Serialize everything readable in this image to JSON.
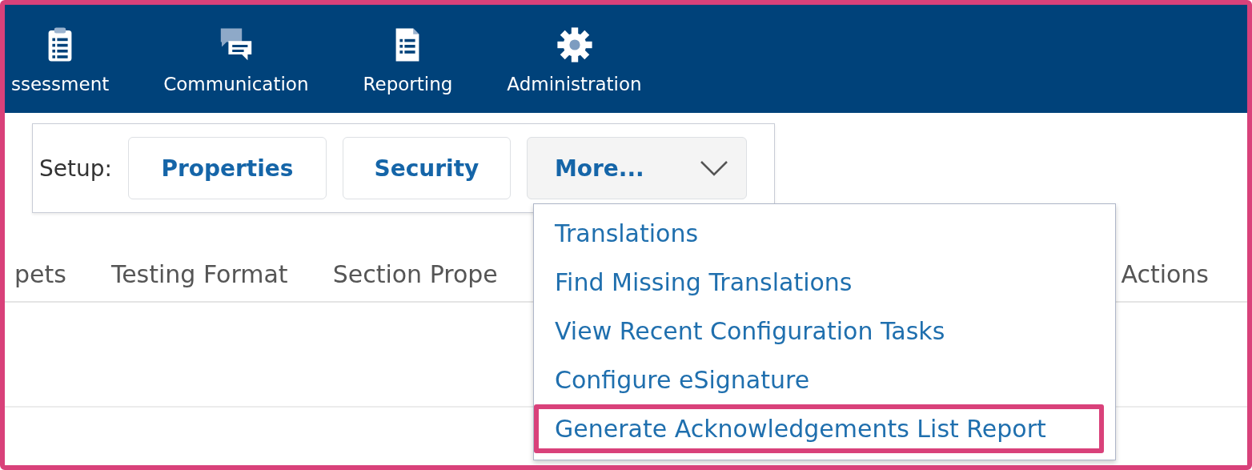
{
  "nav": {
    "items": [
      {
        "label": "ssessment",
        "kind": "clipboard"
      },
      {
        "label": "Communication",
        "kind": "chat"
      },
      {
        "label": "Reporting",
        "kind": "document"
      },
      {
        "label": "Administration",
        "kind": "gear"
      }
    ]
  },
  "setup": {
    "label": "Setup:",
    "buttons": [
      {
        "label": "Properties",
        "kind": "plain"
      },
      {
        "label": "Security",
        "kind": "plain"
      },
      {
        "label": "More...",
        "kind": "dropdown"
      }
    ]
  },
  "tabs": [
    "pets",
    "Testing Format",
    "Section Prope"
  ],
  "tab_right": "Actions",
  "menu": {
    "items": [
      {
        "label": "Translations",
        "highlighted": false
      },
      {
        "label": "Find Missing Translations",
        "highlighted": false
      },
      {
        "label": "View Recent Configuration Tasks",
        "highlighted": false
      },
      {
        "label": "Configure eSignature",
        "highlighted": false
      },
      {
        "label": "Generate Acknowledgements List Report",
        "highlighted": true
      }
    ]
  }
}
